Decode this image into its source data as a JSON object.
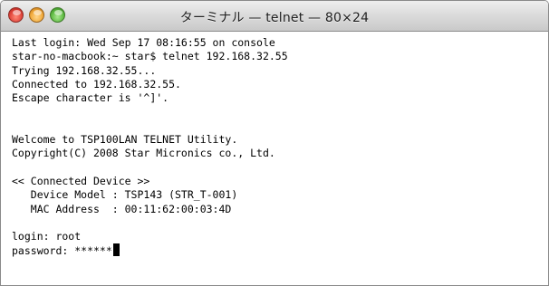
{
  "window": {
    "title": "ターミナル — telnet — 80×24"
  },
  "controls": {
    "close": "close-button",
    "minimize": "minimize-button",
    "zoom": "zoom-button"
  },
  "terminal": {
    "lines": [
      "Last login: Wed Sep 17 08:16:55 on console",
      "star-no-macbook:~ star$ telnet 192.168.32.55",
      "Trying 192.168.32.55...",
      "Connected to 192.168.32.55.",
      "Escape character is '^]'.",
      "",
      "",
      "Welcome to TSP100LAN TELNET Utility.",
      "Copyright(C) 2008 Star Micronics co., Ltd.",
      "",
      "<< Connected Device >>",
      "   Device Model : TSP143 (STR_T-001)",
      "   MAC Address  : 00:11:62:00:03:4D",
      "",
      "login: root",
      "password: ******"
    ]
  }
}
